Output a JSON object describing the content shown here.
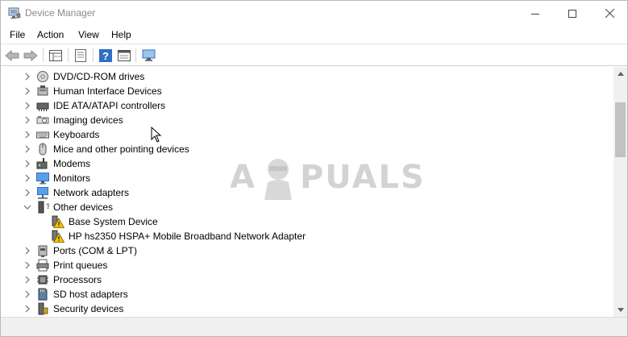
{
  "window": {
    "title": "Device Manager"
  },
  "menu": [
    "File",
    "Action",
    "View",
    "Help"
  ],
  "toolbar": {
    "icons": [
      "back-arrow-icon",
      "forward-arrow-icon",
      "properties-grid-icon",
      "device-list-icon",
      "help-icon",
      "resources-view-icon",
      "monitor-scan-icon"
    ]
  },
  "tree": {
    "items": [
      {
        "label": "DVD/CD-ROM drives",
        "icon": "dvd-drive-icon",
        "expanded": false,
        "level": 0
      },
      {
        "label": "Human Interface Devices",
        "icon": "hid-icon",
        "expanded": false,
        "level": 0
      },
      {
        "label": "IDE ATA/ATAPI controllers",
        "icon": "ide-controller-icon",
        "expanded": false,
        "level": 0
      },
      {
        "label": "Imaging devices",
        "icon": "camera-icon",
        "expanded": false,
        "level": 0
      },
      {
        "label": "Keyboards",
        "icon": "keyboard-icon",
        "expanded": false,
        "level": 0
      },
      {
        "label": "Mice and other pointing devices",
        "icon": "mouse-icon",
        "expanded": false,
        "level": 0
      },
      {
        "label": "Modems",
        "icon": "modem-icon",
        "expanded": false,
        "level": 0
      },
      {
        "label": "Monitors",
        "icon": "monitor-icon",
        "expanded": false,
        "level": 0
      },
      {
        "label": "Network adapters",
        "icon": "network-adapter-icon",
        "expanded": false,
        "level": 0
      },
      {
        "label": "Other devices",
        "icon": "unknown-device-icon",
        "expanded": true,
        "level": 0
      },
      {
        "label": "Base System Device",
        "icon": "warning-device-icon",
        "expanded": null,
        "level": 1
      },
      {
        "label": "HP hs2350 HSPA+ Mobile Broadband Network Adapter",
        "icon": "warning-device-icon",
        "expanded": null,
        "level": 1
      },
      {
        "label": "Ports (COM & LPT)",
        "icon": "port-icon",
        "expanded": false,
        "level": 0
      },
      {
        "label": "Print queues",
        "icon": "printer-icon",
        "expanded": false,
        "level": 0
      },
      {
        "label": "Processors",
        "icon": "processor-icon",
        "expanded": false,
        "level": 0
      },
      {
        "label": "SD host adapters",
        "icon": "sd-card-icon",
        "expanded": false,
        "level": 0
      },
      {
        "label": "Security devices",
        "icon": "security-device-icon",
        "expanded": false,
        "level": 0
      }
    ]
  },
  "watermark": {
    "left": "A",
    "right": "PUALS"
  },
  "colors": {
    "icon_blue": "#2f6fc4",
    "warning_yellow": "#f5c400",
    "chevron": "#6e6e6e",
    "scroll_thumb": "#c2c2c2"
  }
}
